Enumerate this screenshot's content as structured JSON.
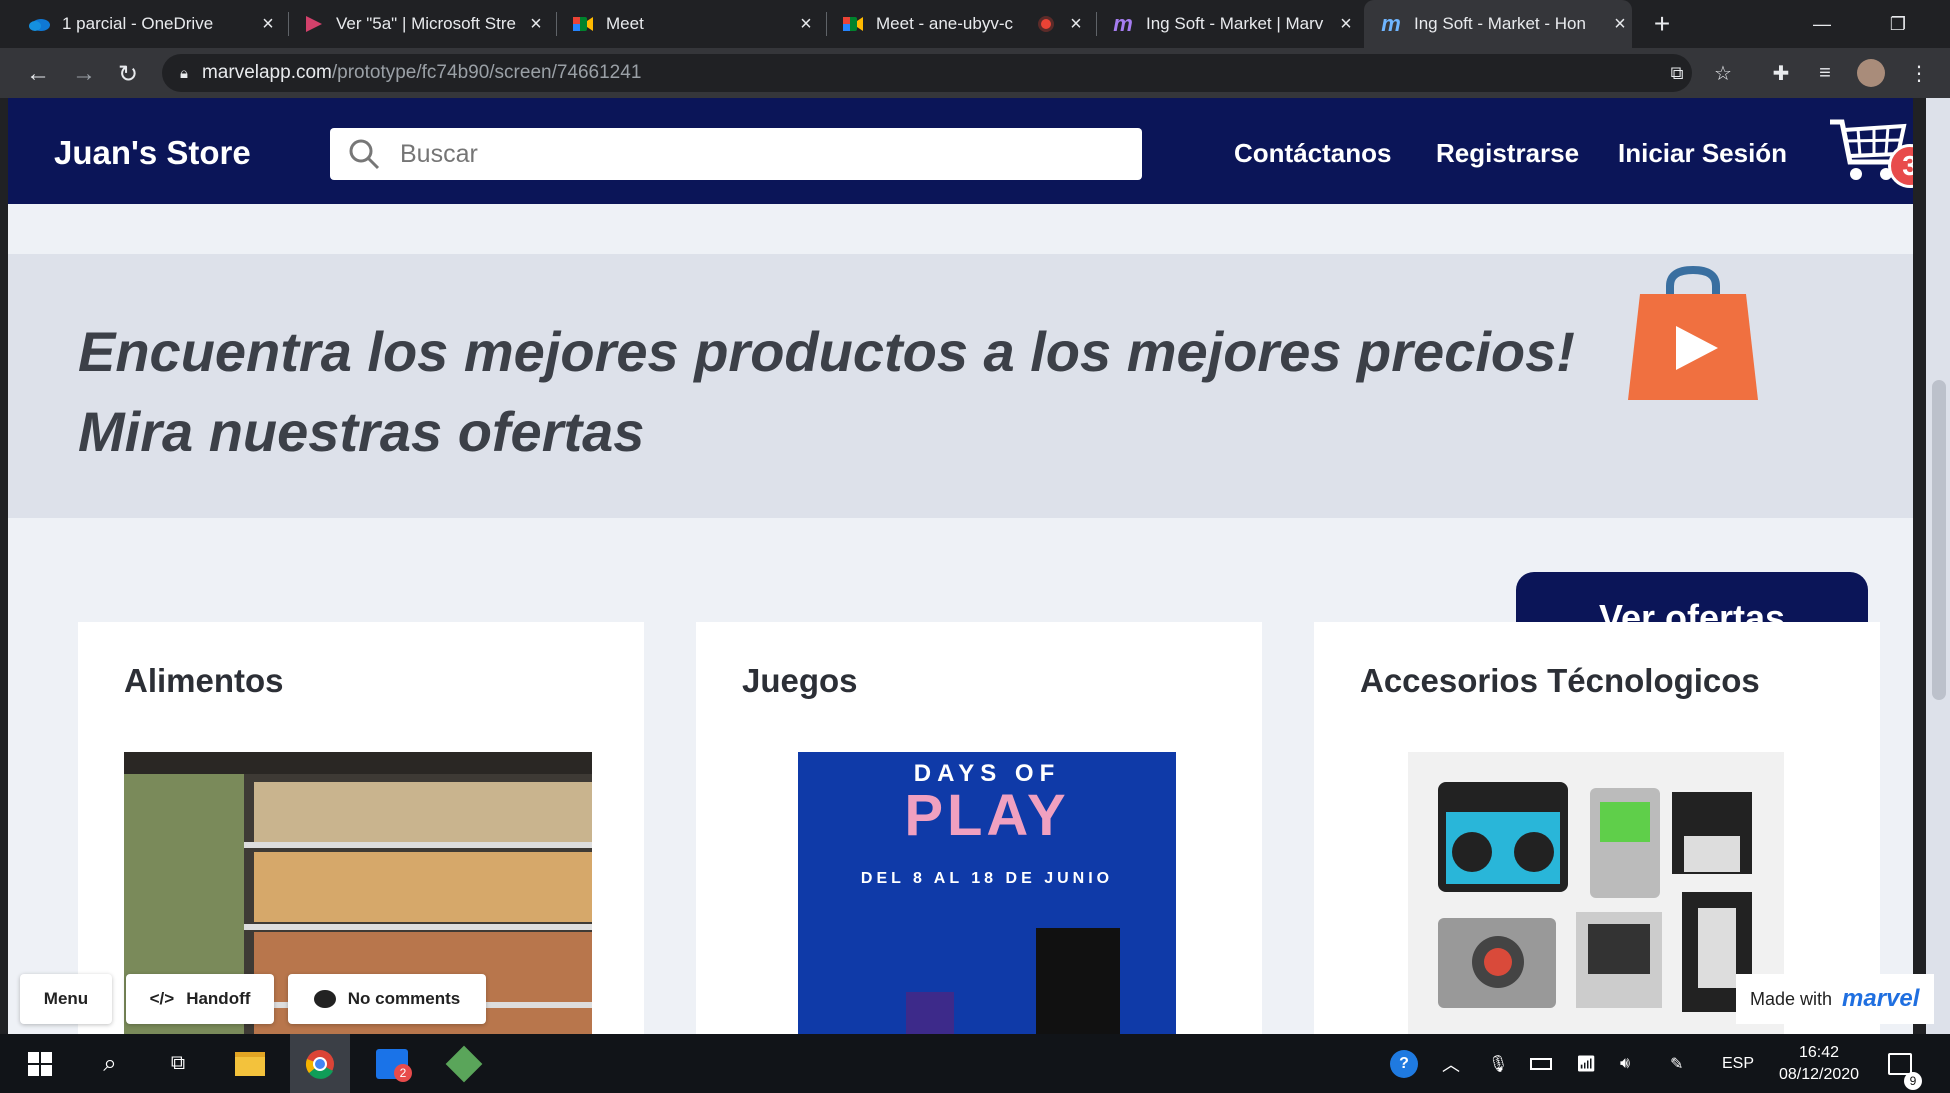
{
  "browser": {
    "tabs": [
      {
        "title": "1 parcial - OneDrive",
        "icon": "onedrive-icon"
      },
      {
        "title": "Ver \"5a\" | Microsoft Stre",
        "icon": "stream-icon"
      },
      {
        "title": "Meet",
        "icon": "meet-icon"
      },
      {
        "title": "Meet - ane-ubyv-c",
        "icon": "meet-icon"
      },
      {
        "title": "Ing Soft - Market | Marv",
        "icon": "marvel-icon"
      },
      {
        "title": "Ing Soft - Market - Hon",
        "icon": "marvel-icon"
      }
    ],
    "url_domain": "marvelapp.com",
    "url_path": "/prototype/fc74b90/screen/74661241"
  },
  "store": {
    "logo": "Juan's Store",
    "search_placeholder": "Buscar",
    "nav": [
      "Contáctanos",
      "Registrarse",
      "Iniciar Sesión"
    ],
    "cart_count": "3",
    "hero_line1": "Encuentra los mejores productos a los mejores precios!",
    "hero_line2": "Mira nuestras ofertas",
    "offers_button": "Ver ofertas",
    "categories": [
      {
        "title": "Alimentos"
      },
      {
        "title": "Juegos",
        "image_text_1": "DAYS OF",
        "image_text_2": "PLAY",
        "image_text_3": "DEL 8 AL 18 DE JUNIO"
      },
      {
        "title": "Accesorios Técnologicos"
      }
    ]
  },
  "marvel": {
    "menu": "Menu",
    "handoff": "Handoff",
    "comments": "No comments",
    "made_with": "Made with",
    "brand": "marvel"
  },
  "taskbar": {
    "lang": "ESP",
    "time": "16:42",
    "date": "08/12/2020",
    "notif_count": "9",
    "app_badge": "2"
  },
  "colors": {
    "navy": "#0b1558",
    "accent": "#f07040",
    "badge": "#e84b4b"
  }
}
